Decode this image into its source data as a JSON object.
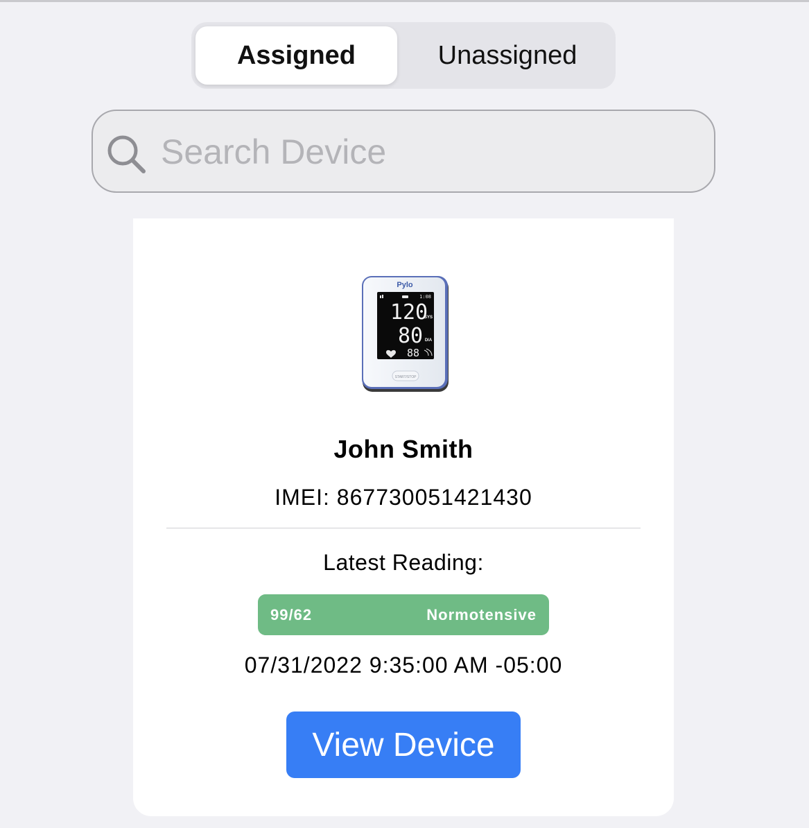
{
  "segmented_control": {
    "options": [
      {
        "label": "Assigned",
        "selected": true
      },
      {
        "label": "Unassigned",
        "selected": false
      }
    ]
  },
  "search": {
    "placeholder": "Search Device",
    "value": ""
  },
  "device_card": {
    "device_image": {
      "brand": "Pylo",
      "display": {
        "sys": "120",
        "sys_label": "SYS",
        "dia": "80",
        "dia_label": "DIA",
        "pulse": "88",
        "time": "1:08",
        "button": "START/STOP"
      }
    },
    "patient_name": "John Smith",
    "imei_text": "IMEI: 867730051421430",
    "latest_reading_label": "Latest Reading:",
    "reading": {
      "value": "99/62",
      "status": "Normotensive",
      "status_color": "#6fbb85"
    },
    "timestamp": "07/31/2022 9:35:00 AM -05:00",
    "view_button_label": "View Device",
    "view_button_color": "#377ef5"
  }
}
